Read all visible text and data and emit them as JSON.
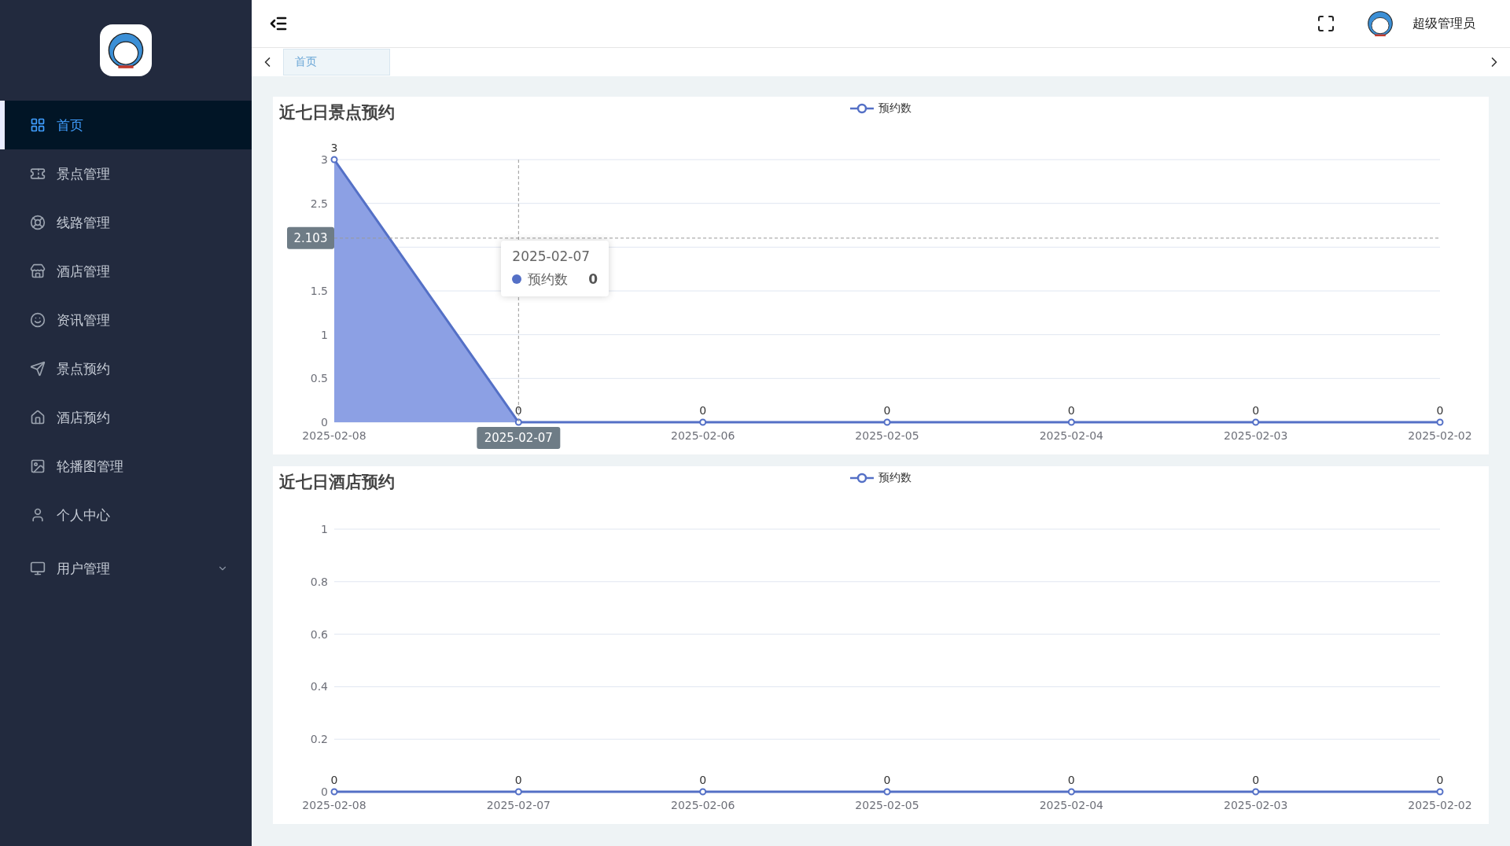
{
  "sidebar": {
    "items": [
      {
        "label": "首页",
        "selected": true
      },
      {
        "label": "景点管理",
        "selected": false
      },
      {
        "label": "线路管理",
        "selected": false
      },
      {
        "label": "酒店管理",
        "selected": false
      },
      {
        "label": "资讯管理",
        "selected": false
      },
      {
        "label": "景点预约",
        "selected": false
      },
      {
        "label": "酒店预约",
        "selected": false
      },
      {
        "label": "轮播图管理",
        "selected": false
      },
      {
        "label": "个人中心",
        "selected": false
      },
      {
        "label": "用户管理",
        "selected": false,
        "expandable": true
      }
    ]
  },
  "header": {
    "user_name": "超级管理员"
  },
  "tabs": [
    {
      "label": "首页",
      "selected": true
    }
  ],
  "charts": [
    {
      "title": "近七日景点预约",
      "tooltip": {
        "title": "2025-02-07",
        "series": "预约数",
        "value": "0"
      },
      "chart_data": {
        "type": "area",
        "categories": [
          "2025-02-08",
          "2025-02-07",
          "2025-02-06",
          "2025-02-05",
          "2025-02-04",
          "2025-02-03",
          "2025-02-02"
        ],
        "series": [
          {
            "name": "预约数",
            "color": "#5470c6",
            "values": [
              3,
              0,
              0,
              0,
              0,
              0,
              0
            ],
            "marker": true
          }
        ],
        "ylim": [
          0,
          3
        ],
        "yticks": [
          0,
          0.5,
          1,
          1.5,
          2.5,
          3
        ],
        "grid": true,
        "data_labels": true,
        "ref_lines": [
          {
            "axis": "x",
            "value": "2025-02-07",
            "label": "2025-02-07"
          },
          {
            "axis": "y",
            "value": 2.103,
            "label": "2.103"
          }
        ]
      }
    },
    {
      "title": "近七日酒店预约",
      "chart_data": {
        "type": "line",
        "categories": [
          "2025-02-08",
          "2025-02-07",
          "2025-02-06",
          "2025-02-05",
          "2025-02-04",
          "2025-02-03",
          "2025-02-02"
        ],
        "series": [
          {
            "name": "预约数",
            "color": "#5470c6",
            "values": [
              0,
              0,
              0,
              0,
              0,
              0,
              0
            ],
            "marker": true
          }
        ],
        "ylim": [
          0,
          1
        ],
        "yticks": [
          0,
          0.2,
          0.4,
          0.6,
          0.8,
          1
        ],
        "grid": true,
        "data_labels": true
      }
    }
  ]
}
